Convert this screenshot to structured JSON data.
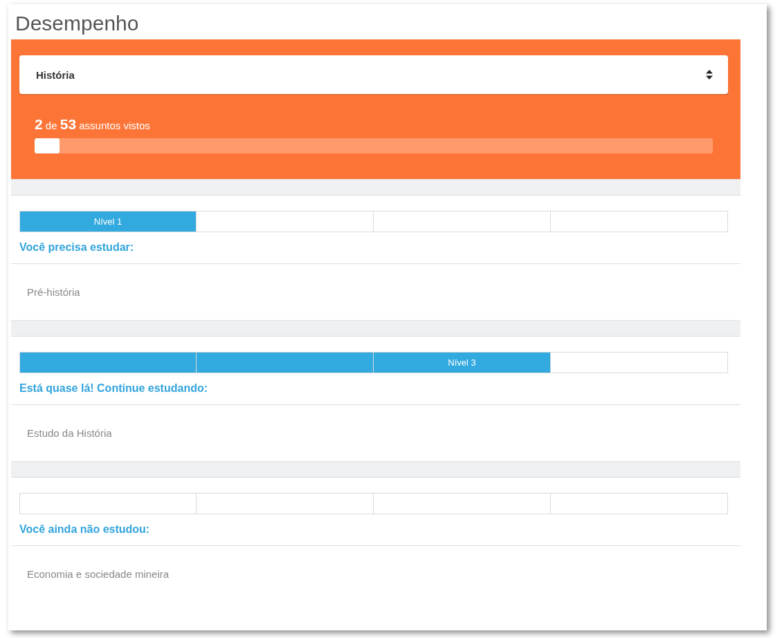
{
  "title": "Desempenho",
  "subject_select": {
    "value": "História"
  },
  "progress": {
    "text": "**2** de **53** assuntos vistos",
    "level": 0.037
  },
  "sections": [
    {
      "segments": [
        {
          "filled": true,
          "label": "Nível 1"
        },
        {
          "filled": false
        },
        {
          "filled": false
        },
        {
          "filled": false
        }
      ],
      "heading": "Você precisa estudar:",
      "topics": [
        "Pré-história"
      ]
    },
    {
      "segments": [
        {
          "filled": true
        },
        {
          "filled": true
        },
        {
          "filled": true,
          "label": "Nível 3"
        },
        {
          "filled": false
        }
      ],
      "heading": "Está quase lá! Continue estudando:",
      "topics": [
        "Estudo da História"
      ]
    },
    {
      "segments": [
        {
          "filled": false
        },
        {
          "filled": false
        },
        {
          "filled": false
        },
        {
          "filled": false
        }
      ],
      "heading": "Você ainda não estudou:",
      "topics": [
        "Economia e sociedade mineira"
      ]
    }
  ]
}
